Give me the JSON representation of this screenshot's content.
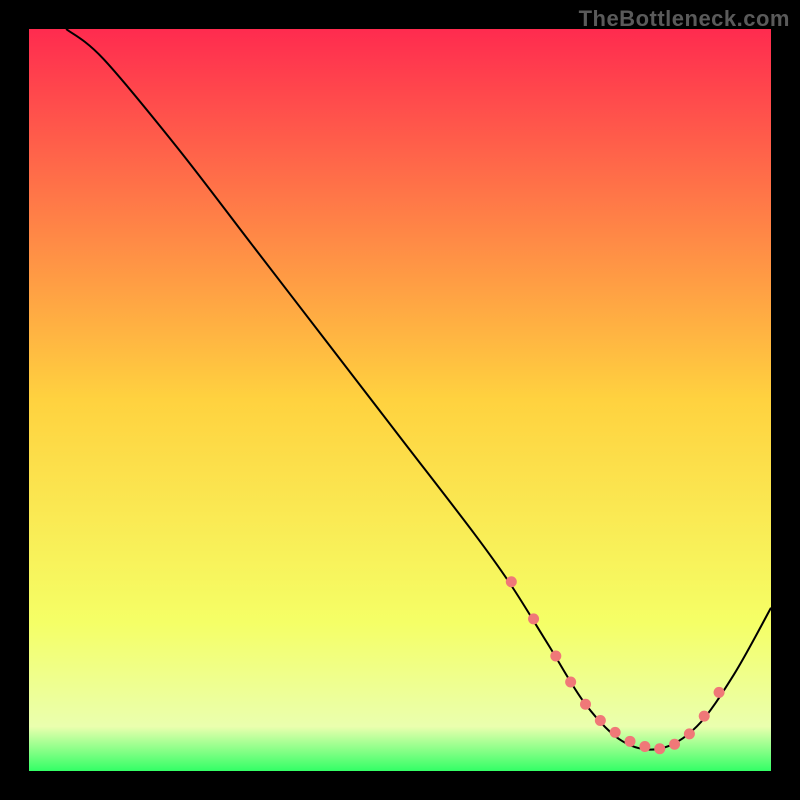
{
  "watermark": "TheBottleneck.com",
  "chart_data": {
    "type": "line",
    "title": "",
    "xlabel": "",
    "ylabel": "",
    "xlim": [
      0,
      100
    ],
    "ylim": [
      0,
      100
    ],
    "grid": false,
    "legend": false,
    "background_gradient": {
      "stops": [
        {
          "offset": 0.0,
          "color": "#ff2b4f"
        },
        {
          "offset": 0.5,
          "color": "#ffd23f"
        },
        {
          "offset": 0.8,
          "color": "#f5ff66"
        },
        {
          "offset": 0.94,
          "color": "#eaffae"
        },
        {
          "offset": 1.0,
          "color": "#33ff66"
        }
      ]
    },
    "series": [
      {
        "name": "curve",
        "color": "#000000",
        "x": [
          5,
          10,
          20,
          30,
          40,
          50,
          60,
          65,
          70,
          75,
          80,
          85,
          90,
          95,
          100
        ],
        "y": [
          100,
          96,
          84,
          71,
          58,
          45,
          32,
          25,
          17,
          9,
          4,
          3,
          6,
          13,
          22
        ]
      }
    ],
    "markers": {
      "name": "selected-range",
      "color": "#f07878",
      "x": [
        65,
        68,
        71,
        73,
        75,
        77,
        79,
        81,
        83,
        85,
        87,
        89,
        91,
        93
      ],
      "y": [
        25.5,
        20.5,
        15.5,
        12.0,
        9.0,
        6.8,
        5.2,
        4.0,
        3.3,
        3.0,
        3.6,
        5.0,
        7.4,
        10.6
      ]
    }
  }
}
